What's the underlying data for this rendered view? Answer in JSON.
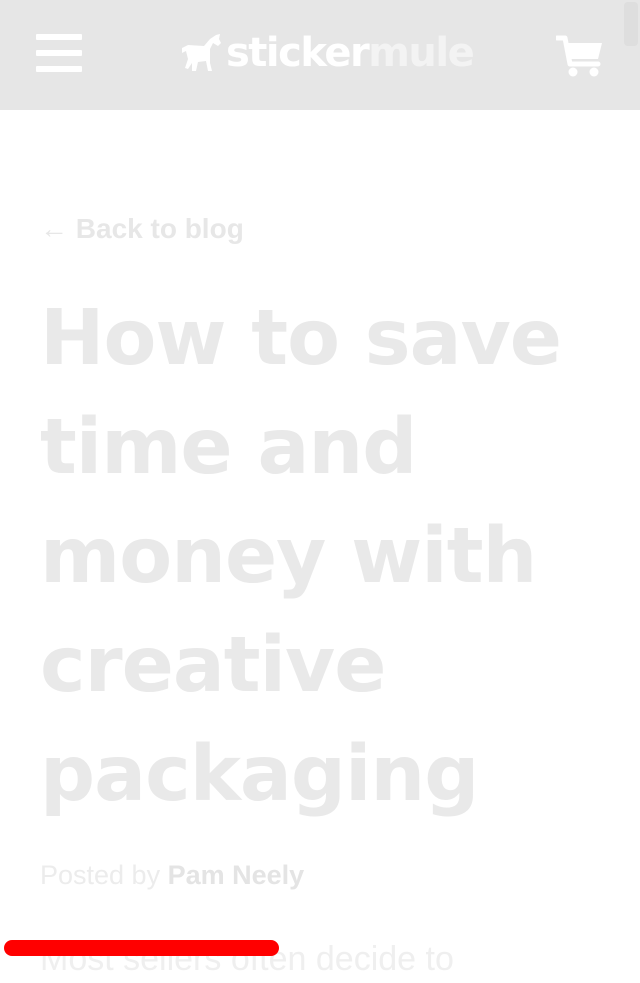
{
  "header": {
    "background": "#e6e6e6",
    "logo": {
      "part1": "sticker",
      "part2": "mule"
    },
    "menu_icon": "hamburger-menu-icon",
    "cart_icon": "shopping-cart-icon"
  },
  "article": {
    "back_link": "← Back to blog",
    "title": "How to save time and money with creative packaging",
    "byline_prefix": "Posted by",
    "author": "Pam Neely",
    "excerpt_partial": "Most sellers often decide to"
  },
  "reading_progress": {
    "fraction": 0.43,
    "color": "#ff0000"
  }
}
